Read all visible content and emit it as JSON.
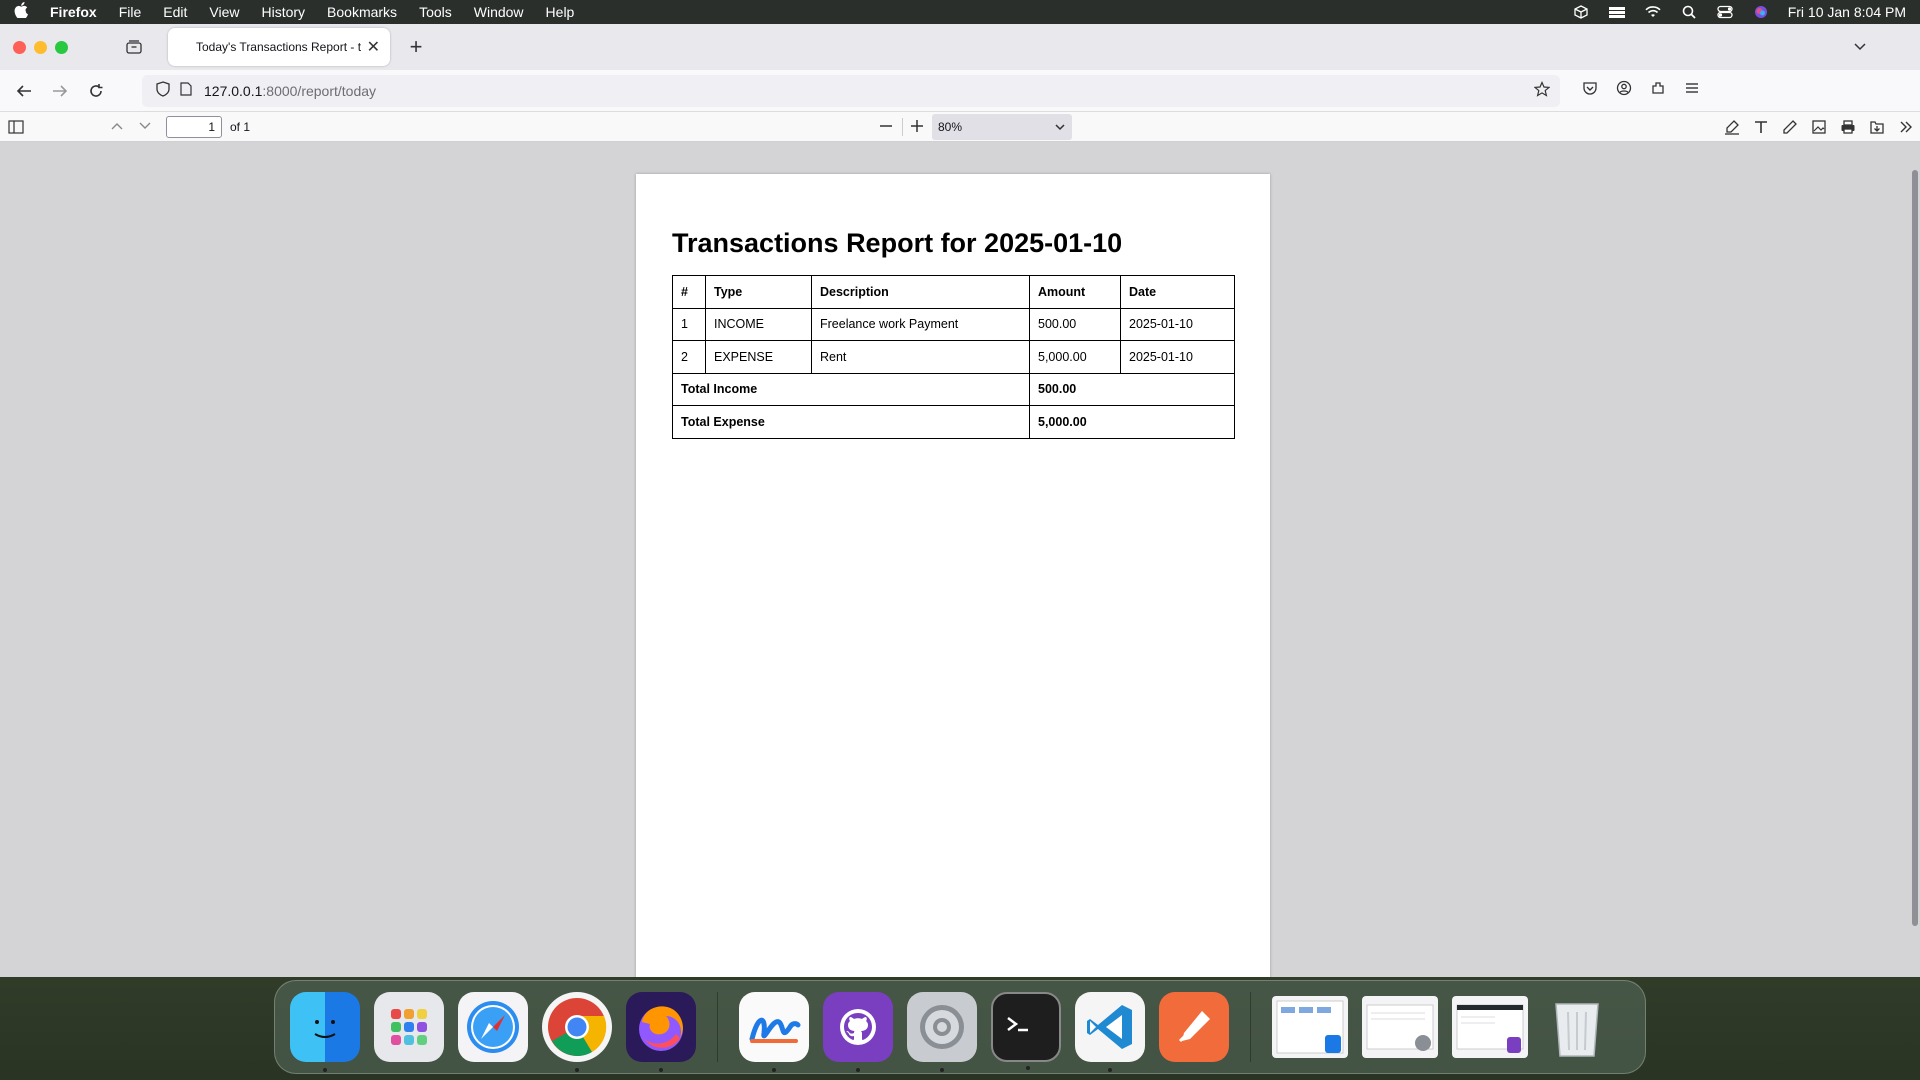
{
  "menubar": {
    "app_name": "Firefox",
    "menus": [
      "File",
      "Edit",
      "View",
      "History",
      "Bookmarks",
      "Tools",
      "Window",
      "Help"
    ],
    "clock": "Fri 10 Jan  8:04 PM"
  },
  "browser": {
    "tab_title": "Today's Transactions Report - t",
    "url_host": "127.0.0.1",
    "url_rest": ":8000/report/today"
  },
  "pdf_toolbar": {
    "page_number": "1",
    "page_of": "of 1",
    "zoom": "80%"
  },
  "report": {
    "title": "Transactions Report for 2025-01-10",
    "columns": [
      "#",
      "Type",
      "Description",
      "Amount",
      "Date"
    ],
    "rows": [
      {
        "num": "1",
        "type": "INCOME",
        "description": "Freelance work Payment",
        "amount": "500.00",
        "date": "2025-01-10"
      },
      {
        "num": "2",
        "type": "EXPENSE",
        "description": "Rent",
        "amount": "5,000.00",
        "date": "2025-01-10"
      }
    ],
    "totals": [
      {
        "label": "Total Income",
        "value": "500.00"
      },
      {
        "label": "Total Expense",
        "value": "5,000.00"
      }
    ]
  },
  "dock": {
    "apps": [
      "Finder",
      "Launchpad",
      "Safari",
      "Google Chrome",
      "Firefox",
      "Freeform",
      "GitHub Desktop",
      "System Settings",
      "Terminal",
      "Visual Studio Code",
      "Postman"
    ]
  }
}
